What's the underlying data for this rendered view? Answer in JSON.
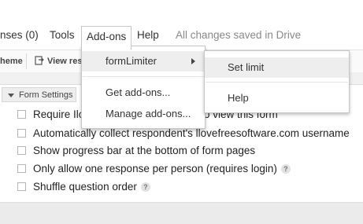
{
  "menubar": {
    "responses": "nses (0)",
    "tools": "Tools",
    "addons": "Add-ons",
    "help": "Help",
    "status": "All changes saved in Drive"
  },
  "toolbar": {
    "theme": "heme",
    "view": "View res"
  },
  "addons_menu": {
    "form_limiter": "formLimiter",
    "get_addons": "Get add-ons...",
    "manage_addons": "Manage add-ons..."
  },
  "submenu": {
    "set_limit": "Set limit",
    "help": "Help"
  },
  "form_settings": {
    "tab_label": "Form Settings",
    "options": [
      {
        "label": "Require Ilove",
        "suffix": "o view this form",
        "help": false
      },
      {
        "label": "Automatically collect respondent's llovefreesoftware.com username",
        "help": false
      },
      {
        "label": "Show progress bar at the bottom of form pages",
        "help": false
      },
      {
        "label": "Only allow one response per person (requires login)",
        "help": true
      },
      {
        "label": "Shuffle question order",
        "help": true
      }
    ],
    "help_glyph": "?"
  }
}
